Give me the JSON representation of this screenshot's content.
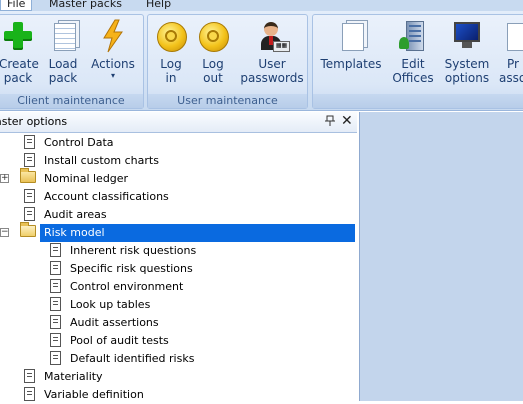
{
  "menu": {
    "tabs": [
      {
        "label": "File"
      },
      {
        "label": "Master packs"
      },
      {
        "label": "Help"
      }
    ]
  },
  "ribbon": {
    "groups": [
      {
        "label": "Client maintenance",
        "buttons": [
          {
            "label": "Create",
            "label2": "pack",
            "icon": "create-pack-icon"
          },
          {
            "label": "Load",
            "label2": "pack",
            "icon": "load-pack-icon"
          },
          {
            "label": "Actions",
            "label2": "▾",
            "icon": "actions-icon"
          }
        ]
      },
      {
        "label": "User maintenance",
        "buttons": [
          {
            "label": "Log",
            "label2": "in",
            "icon": "log-in-icon"
          },
          {
            "label": "Log",
            "label2": "out",
            "icon": "log-out-icon"
          },
          {
            "label": "User",
            "label2": "passwords",
            "icon": "user-passwords-icon"
          }
        ]
      },
      {
        "label": "",
        "buttons": [
          {
            "label": "Templates",
            "label2": "",
            "icon": "templates-icon"
          },
          {
            "label": "Edit",
            "label2": "Offices",
            "icon": "edit-offices-icon"
          },
          {
            "label": "System",
            "label2": "options",
            "icon": "system-options-icon"
          },
          {
            "label": "Pr",
            "label2": "assoc",
            "icon": "partial-icon"
          }
        ]
      }
    ]
  },
  "panel": {
    "title": "aster options",
    "pin_glyph": "⊥",
    "close_glyph": "✕"
  },
  "tree": {
    "items": [
      {
        "label": "Control Data",
        "icon": "document-icon",
        "level": 0
      },
      {
        "label": "Install custom charts",
        "icon": "document-icon",
        "level": 0
      },
      {
        "label": "Nominal ledger",
        "icon": "folder-icon",
        "level": 0,
        "expander": "+"
      },
      {
        "label": "Account classifications",
        "icon": "document-icon",
        "level": 0
      },
      {
        "label": "Audit areas",
        "icon": "document-icon",
        "level": 0
      },
      {
        "label": "Risk model",
        "icon": "open-folder-icon",
        "level": 0,
        "expander": "−",
        "selected": true
      },
      {
        "label": "Inherent risk questions",
        "icon": "document-icon",
        "level": 1
      },
      {
        "label": "Specific risk questions",
        "icon": "document-icon",
        "level": 1
      },
      {
        "label": "Control environment",
        "icon": "document-icon",
        "level": 1
      },
      {
        "label": "Look up tables",
        "icon": "document-icon",
        "level": 1
      },
      {
        "label": "Audit assertions",
        "icon": "document-icon",
        "level": 1
      },
      {
        "label": "Pool of audit tests",
        "icon": "document-icon",
        "level": 1
      },
      {
        "label": "Default identified risks",
        "icon": "document-icon",
        "level": 1
      },
      {
        "label": "Materiality",
        "icon": "document-icon",
        "level": 0
      },
      {
        "label": "Variable definition",
        "icon": "document-icon",
        "level": 0
      }
    ]
  },
  "colors": {
    "selection": "#0a6ae0",
    "ribbon_text": "#1e3f72",
    "group_label": "#3d5f8f",
    "workspace": "#c3d5ec"
  }
}
